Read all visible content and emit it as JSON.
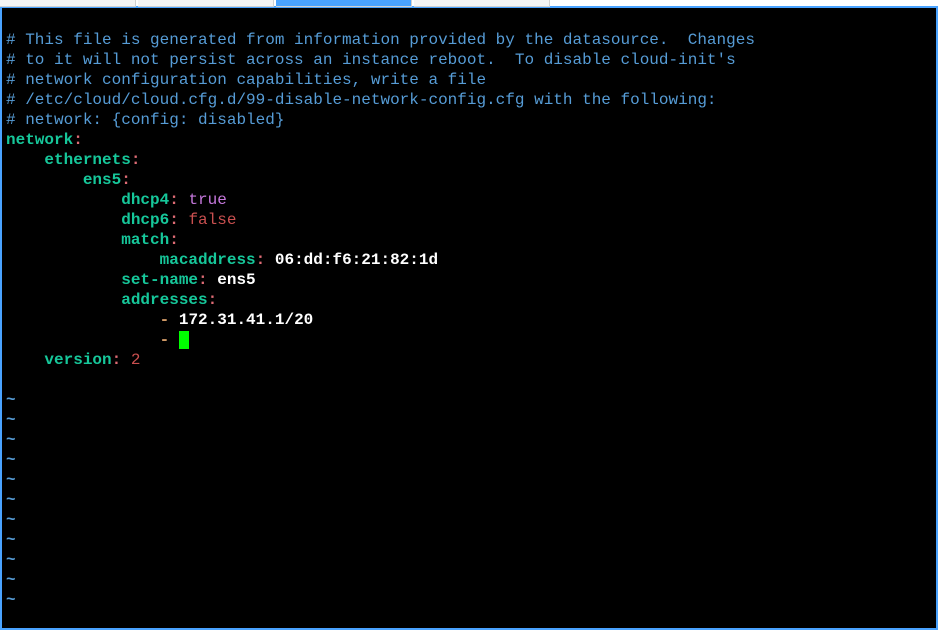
{
  "comments": {
    "l1": "# This file is generated from information provided by the datasource.  Changes",
    "l2": "# to it will not persist across an instance reboot.  To disable cloud-init's",
    "l3": "# network configuration capabilities, write a file",
    "l4": "# /etc/cloud/cloud.cfg.d/99-disable-network-config.cfg with the following:",
    "l5": "# network: {config: disabled}"
  },
  "yaml": {
    "network_key": "network",
    "ethernets_key": "ethernets",
    "iface_key": "ens5",
    "dhcp4_key": "dhcp4",
    "dhcp4_val": "true",
    "dhcp6_key": "dhcp6",
    "dhcp6_val": "false",
    "match_key": "match",
    "macaddress_key": "macaddress",
    "macaddress_val": "06:dd:f6:21:82:1d",
    "setname_key": "set-name",
    "setname_val": "ens5",
    "addresses_key": "addresses",
    "addr1": "172.31.41.1/20",
    "version_key": "version",
    "version_val": "2"
  },
  "glyphs": {
    "colon": ":",
    "dash": "-",
    "tilde": "~"
  }
}
